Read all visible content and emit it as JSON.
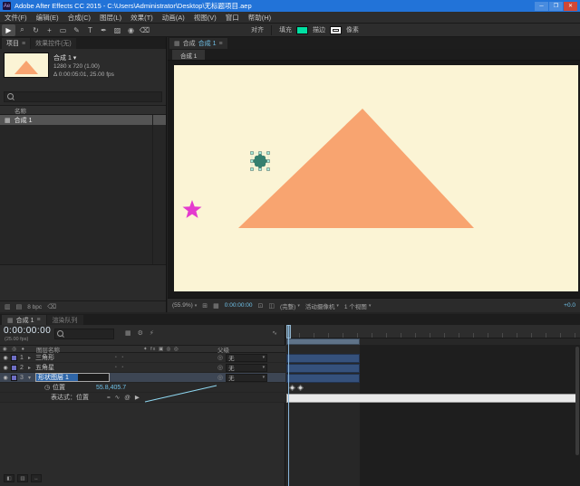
{
  "window": {
    "app_badge": "Ae",
    "title": "Adobe After Effects CC 2015 - C:\\Users\\Administrator\\Desktop\\无标题项目.aep",
    "minimize_glyph": "─",
    "maximize_glyph": "❐",
    "close_glyph": "✕"
  },
  "menubar": {
    "items": [
      "文件(F)",
      "编辑(E)",
      "合成(C)",
      "图层(L)",
      "效果(T)",
      "动画(A)",
      "视图(V)",
      "窗口",
      "帮助(H)"
    ]
  },
  "toolbar": {
    "tools": [
      "▶",
      "⌕",
      "↻",
      "+",
      "▭",
      "✎",
      "T",
      "✒",
      "▨",
      "◉",
      "⌫"
    ],
    "align_label": "对齐",
    "fill_label": "填充",
    "fill_color": "#00e0a3",
    "stroke_label": "描边",
    "pixel_label": "像素"
  },
  "project": {
    "tab_project": "项目",
    "tab_effects": "效果控件(无)",
    "menu_glyph": "≡",
    "comp_name": "合成 1 ▾",
    "comp_size": "1280 x 720 (1.00)",
    "comp_meta": "Δ 0:00:05:01, 25.00 fps",
    "name_col": "名称",
    "item_label": "合成 1",
    "item_icon": "▦",
    "bpc": "8 bpc",
    "footer_icon1": "▥",
    "footer_icon2": "▤",
    "trash_glyph": "⌫"
  },
  "viewer": {
    "tab_icon": "▦",
    "panel_label": "合成",
    "comp_tab": "合成 1",
    "menu_glyph": "≡",
    "mini_tab": "合成 1",
    "zoom": "(55.9%)",
    "timecode": "0:00:00:00",
    "resolution": "(完整)",
    "camera": "活动摄像机",
    "views": "1 个视图",
    "exposure": "+0.0",
    "icon_region": "⊞",
    "icon_grid": "▦",
    "icon_channels": "◫",
    "icon_snapshot": "⊡"
  },
  "comp_colors": {
    "background": "#fbf4d5",
    "triangle": "#f8a470",
    "star": "#e43ace",
    "flower": "#35806f"
  },
  "timeline": {
    "tab_icon": "▦",
    "tab_comp": "合成 1",
    "menu_glyph": "≡",
    "tab_queue": "渲染队列",
    "timecode": "0:00:00:00",
    "fps": "(25.00 fps)",
    "icon_comp": "▦",
    "icon_flow": "⚙",
    "icon_draft": "⚡",
    "icon_graph": "∿",
    "col_av": "◉ ◎ ●",
    "col_name": "图层名称",
    "col_switches": "✦ fx ▣ ◎ ◎",
    "col_parent": "父级",
    "parent_none": "无",
    "eye_glyph": "◉",
    "layers": [
      {
        "num": "1",
        "name": "三角形"
      },
      {
        "num": "2",
        "name": "五角星"
      },
      {
        "num": "3",
        "rename_value": "形状图层 1"
      }
    ],
    "position_label": "位置",
    "position_value": "55.8,405.7",
    "expression_label": "表达式：位置",
    "expr_enable": "=",
    "expr_graph": "∿",
    "expr_pickwhip": "@",
    "expr_lang": "▶",
    "stopwatch_glyph": "◷",
    "toggle1": "◧",
    "toggle2": "▥",
    "toggle3": "↔"
  }
}
